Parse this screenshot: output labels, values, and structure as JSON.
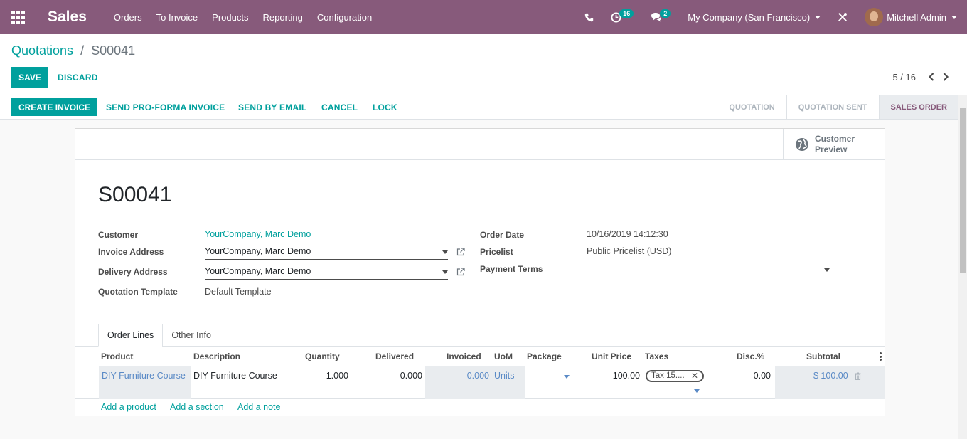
{
  "navbar": {
    "app_name": "Sales",
    "menu": [
      "Orders",
      "To Invoice",
      "Products",
      "Reporting",
      "Configuration"
    ],
    "activity_count": "16",
    "message_count": "2",
    "company": "My Company (San Francisco)",
    "user": "Mitchell Admin"
  },
  "breadcrumb": {
    "parent": "Quotations",
    "separator": "/",
    "current": "S00041"
  },
  "buttons": {
    "save": "SAVE",
    "discard": "DISCARD"
  },
  "pager": {
    "value": "5 / 16"
  },
  "status_actions": {
    "create_invoice": "CREATE INVOICE",
    "send_proforma": "SEND PRO-FORMA INVOICE",
    "send_email": "SEND BY EMAIL",
    "cancel": "CANCEL",
    "lock": "LOCK"
  },
  "stages": [
    "QUOTATION",
    "QUOTATION SENT",
    "SALES ORDER"
  ],
  "active_stage": "SALES ORDER",
  "sheet": {
    "preview_line1": "Customer",
    "preview_line2": "Preview",
    "order_name": "S00041"
  },
  "fields": {
    "customer_label": "Customer",
    "customer_value": "YourCompany, Marc Demo",
    "invoice_address_label": "Invoice Address",
    "invoice_address_value": "YourCompany, Marc Demo",
    "delivery_address_label": "Delivery Address",
    "delivery_address_value": "YourCompany, Marc Demo",
    "quotation_template_label": "Quotation Template",
    "quotation_template_value": "Default Template",
    "order_date_label": "Order Date",
    "order_date_value": "10/16/2019 14:12:30",
    "pricelist_label": "Pricelist",
    "pricelist_value": "Public Pricelist (USD)",
    "payment_terms_label": "Payment Terms",
    "payment_terms_value": ""
  },
  "tabs": [
    "Order Lines",
    "Other Info"
  ],
  "table": {
    "headers": [
      "Product",
      "Description",
      "Quantity",
      "Delivered",
      "Invoiced",
      "UoM",
      "Package",
      "Unit Price",
      "Taxes",
      "Disc.%",
      "Subtotal"
    ],
    "row": {
      "product": "DIY Furniture Course",
      "description": "DIY Furniture Course",
      "quantity": "1.000",
      "delivered": "0.000",
      "invoiced": "0.000",
      "uom": "Units",
      "package": "",
      "unit_price": "100.00",
      "tax": "Tax 15....",
      "discount": "0.00",
      "subtotal": "$ 100.00"
    },
    "add_links": [
      "Add a product",
      "Add a section",
      "Add a note"
    ]
  },
  "colors": {
    "brand": "#875a7b",
    "accent": "#00a09d"
  }
}
